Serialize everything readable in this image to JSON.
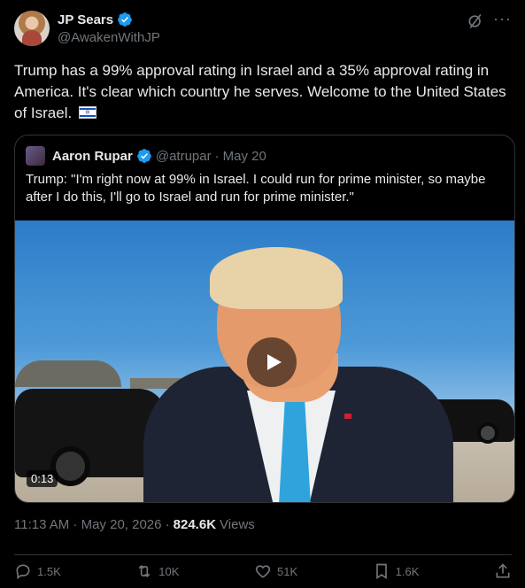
{
  "author": {
    "display_name": "JP Sears",
    "handle": "@AwakenWithJP"
  },
  "post": {
    "text": "Trump has a 99% approval rating in Israel and a 35% approval rating in America. It's clear which country he serves. Welcome to the United States of Israel.",
    "timestamp": "11:13 AM · May 20, 2026 ·",
    "views_count": "824.6K",
    "views_label": "Views"
  },
  "quoted": {
    "display_name": "Aaron Rupar",
    "handle": "@atrupar",
    "separator": "·",
    "date": "May 20",
    "text": "Trump: \"I'm right now at 99% in Israel. I could run for prime minister, so maybe after I do this, I'll go to Israel and run for prime minister.\"",
    "video_duration": "0:13"
  },
  "actions": {
    "replies": "1.5K",
    "reposts": "10K",
    "likes": "51K",
    "bookmarks": "1.6K"
  },
  "colors": {
    "background": "#000000",
    "text": "#e7e9ea",
    "muted": "#71767b",
    "verified": "#1d9bf0",
    "border": "#2f3336"
  }
}
